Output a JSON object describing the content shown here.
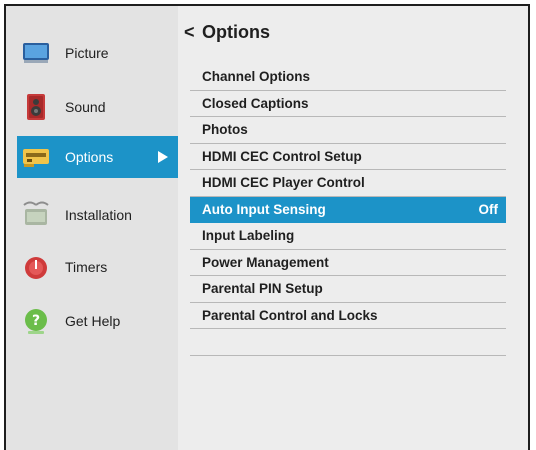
{
  "sidebar": {
    "items": [
      {
        "label": "Picture",
        "icon": "tv-screen-icon"
      },
      {
        "label": "Sound",
        "icon": "speaker-icon"
      },
      {
        "label": "Options",
        "icon": "options-device-icon",
        "selected": true
      },
      {
        "label": "Installation",
        "icon": "satellite-antenna-icon"
      },
      {
        "label": "Timers",
        "icon": "timer-clock-icon"
      },
      {
        "label": "Get Help",
        "icon": "help-question-icon"
      }
    ]
  },
  "main": {
    "back_glyph": "<",
    "title": "Options",
    "menu": [
      {
        "label": "Channel Options",
        "value": ""
      },
      {
        "label": "Closed Captions",
        "value": ""
      },
      {
        "label": "Photos",
        "value": ""
      },
      {
        "label": "HDMI CEC Control Setup",
        "value": ""
      },
      {
        "label": "HDMI CEC Player Control",
        "value": ""
      },
      {
        "label": "Auto Input Sensing",
        "value": "Off",
        "selected": true
      },
      {
        "label": "Input Labeling",
        "value": ""
      },
      {
        "label": "Power Management",
        "value": ""
      },
      {
        "label": "Parental PIN Setup",
        "value": ""
      },
      {
        "label": "Parental Control and Locks",
        "value": ""
      }
    ]
  },
  "colors": {
    "accent": "#1c93c8",
    "sidebar_bg": "#e3e3e3",
    "main_bg": "#ededed",
    "text": "#1f1f1f"
  }
}
